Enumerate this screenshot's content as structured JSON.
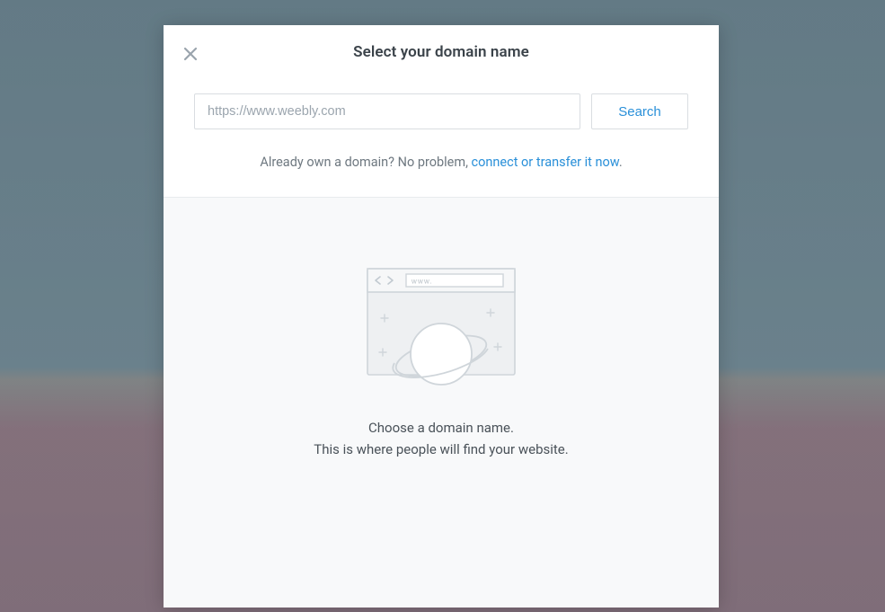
{
  "modal": {
    "title": "Select your domain name"
  },
  "search": {
    "placeholder": "https://www.weebly.com",
    "value": "",
    "button_label": "Search"
  },
  "connect": {
    "prefix": "Already own a domain? No problem, ",
    "link_text": "connect or transfer it now",
    "suffix": "."
  },
  "illustration": {
    "www_label": "www."
  },
  "empty": {
    "line1": "Choose a domain name.",
    "line2": "This is where people will find your website."
  }
}
